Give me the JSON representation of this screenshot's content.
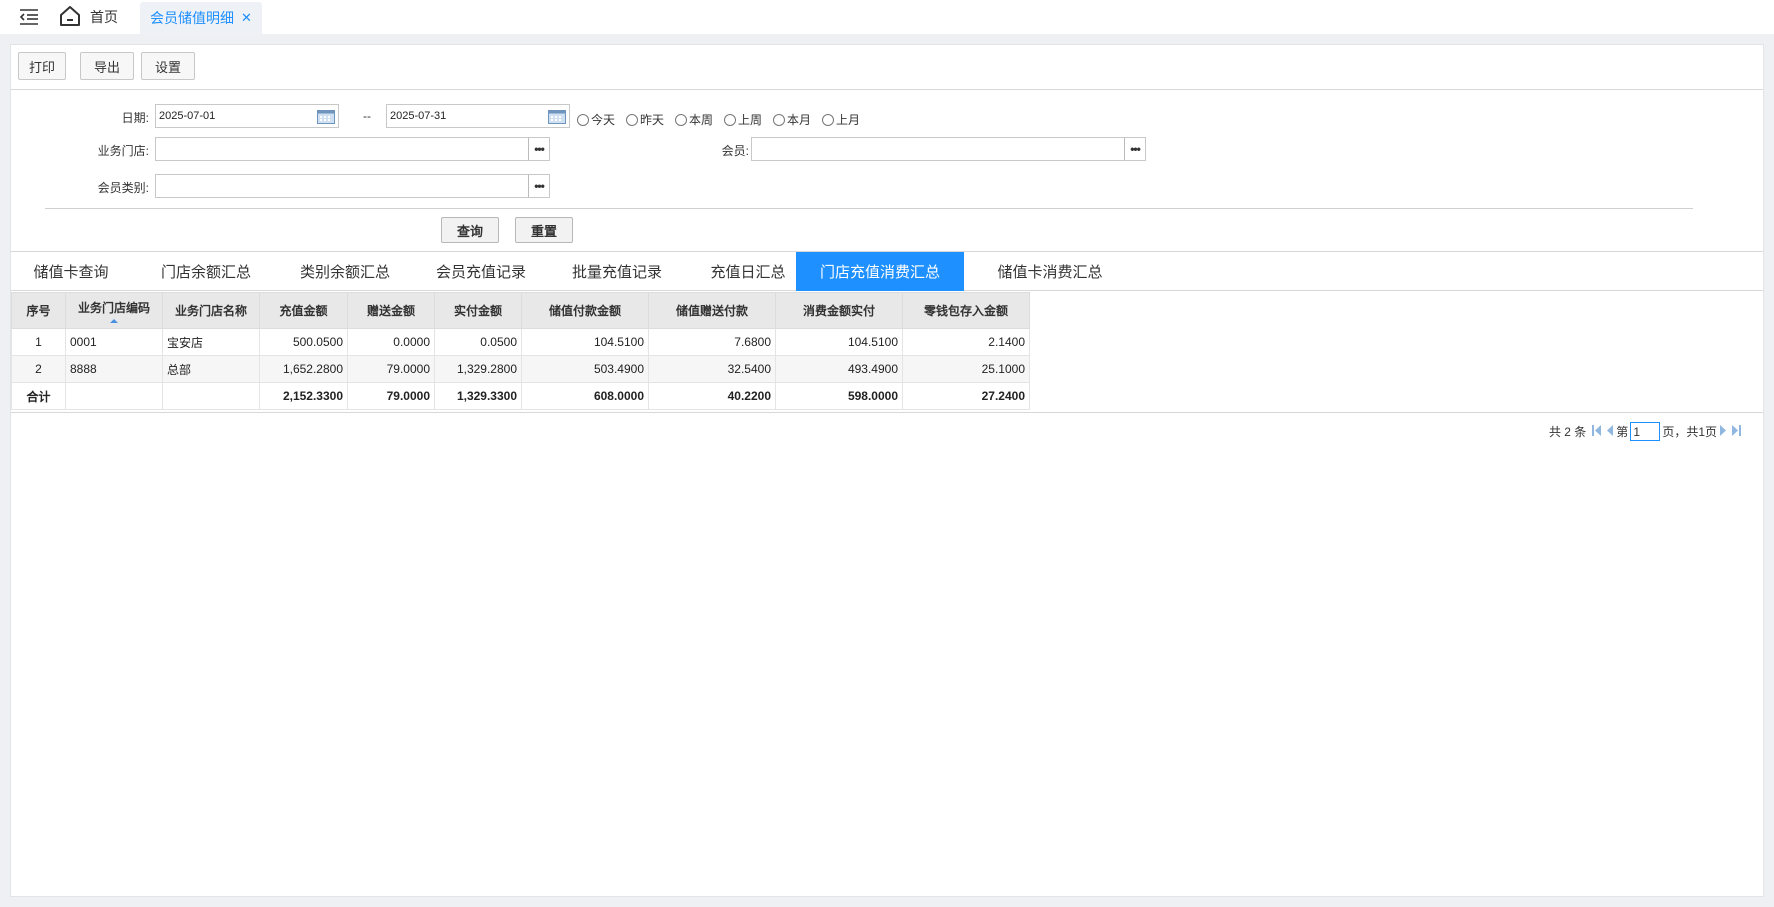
{
  "topbar": {
    "home_label": "首页",
    "active_tab_label": "会员储值明细",
    "close_glyph": "✕",
    "icons": [
      "menu-toggle-icon",
      "home-icon",
      "close-icon"
    ]
  },
  "toolbar": {
    "print_label": "打印",
    "export_label": "导出",
    "settings_label": "设置"
  },
  "filters": {
    "date_label": "日期:",
    "date_from": "2025-07-01",
    "date_sep": "--",
    "date_to": "2025-07-31",
    "quick_ranges": [
      "今天",
      "昨天",
      "本周",
      "上周",
      "本月",
      "上月"
    ],
    "store_label": "业务门店:",
    "store_value": "",
    "member_label": "会员:",
    "member_value": "",
    "member_type_label": "会员类别:",
    "member_type_value": "",
    "picker_glyph": "•••"
  },
  "actions": {
    "query_label": "查询",
    "reset_label": "重置"
  },
  "tabs": [
    {
      "label": "储值卡查询",
      "active": false
    },
    {
      "label": "门店余额汇总",
      "active": false
    },
    {
      "label": "类别余额汇总",
      "active": false
    },
    {
      "label": "会员充值记录",
      "active": false
    },
    {
      "label": "批量充值记录",
      "active": false
    },
    {
      "label": "充值日汇总",
      "active": false
    },
    {
      "label": "门店充值消费汇总",
      "active": true
    },
    {
      "label": "储值卡消费汇总",
      "active": false
    }
  ],
  "table": {
    "headers": [
      "序号",
      "业务门店编码",
      "业务门店名称",
      "充值金额",
      "赠送金额",
      "实付金额",
      "储值付款金额",
      "储值赠送付款",
      "消费金额实付",
      "零钱包存入金额"
    ],
    "rows": [
      [
        "1",
        "0001",
        "宝安店",
        "500.0500",
        "0.0000",
        "0.0500",
        "104.5100",
        "7.6800",
        "104.5100",
        "2.1400"
      ],
      [
        "2",
        "8888",
        "总部",
        "1,652.2800",
        "79.0000",
        "1,329.2800",
        "503.4900",
        "32.5400",
        "493.4900",
        "25.1000"
      ]
    ],
    "total": [
      "合计",
      "",
      "",
      "2,152.3300",
      "79.0000",
      "1,329.3300",
      "608.0000",
      "40.2200",
      "598.0000",
      "27.2400"
    ]
  },
  "pager": {
    "total_text": "共 2 条",
    "page_prefix": "第",
    "page_value": "1",
    "page_suffix": "页，共1页"
  },
  "colors": {
    "accent": "#1e90ff",
    "header_bg": "#e8e8e8",
    "page_bg": "#eef0f4"
  }
}
